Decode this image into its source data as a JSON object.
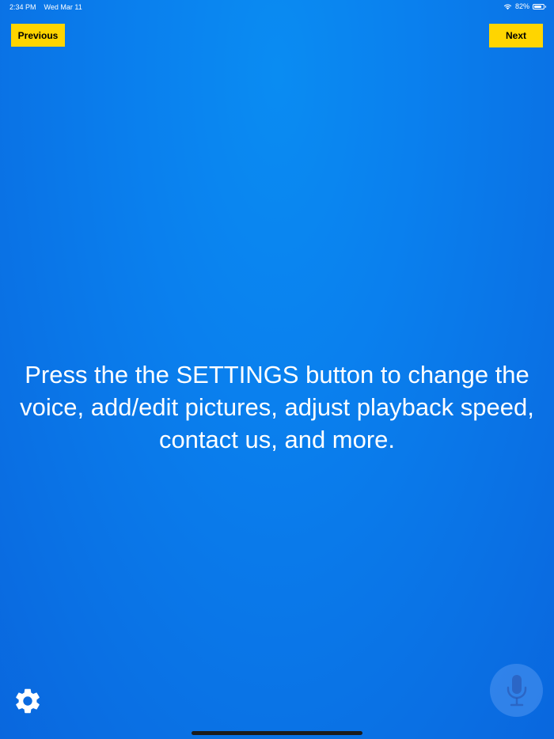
{
  "status_bar": {
    "time": "2:34 PM",
    "date": "Wed Mar 11",
    "battery_percent": "82%",
    "battery_level": 0.82
  },
  "nav": {
    "previous_label": "Previous",
    "next_label": "Next"
  },
  "main": {
    "message": "Press the the SETTINGS button to change the voice, add/edit pictures, adjust playback speed, contact us, and more."
  },
  "icons": {
    "settings": "gear-icon",
    "microphone": "microphone-icon",
    "wifi": "wifi-icon",
    "battery": "battery-icon"
  },
  "colors": {
    "background": "#0a80ee",
    "button": "#ffd500",
    "button_text": "#000000",
    "text": "#ffffff"
  }
}
